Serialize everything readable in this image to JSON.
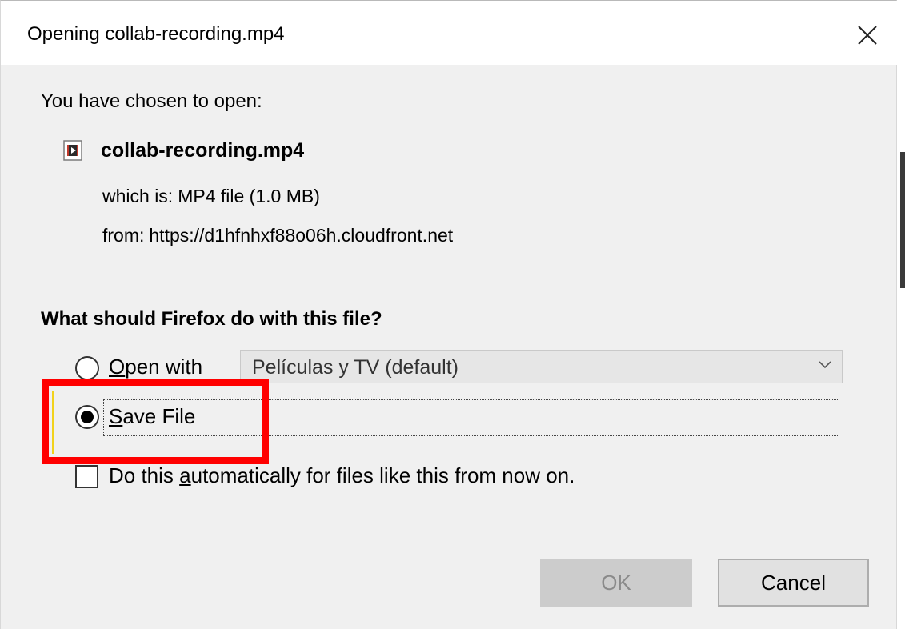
{
  "window": {
    "title": "Opening collab-recording.mp4",
    "close_icon": "close-icon"
  },
  "intro": "You have chosen to open:",
  "file": {
    "icon": "video-file-icon",
    "name": "collab-recording.mp4",
    "type_label": "which is:",
    "type_value": "MP4 file (1.0 MB)",
    "from_label": "from:",
    "from_value": "https://d1hfnhxf88o06h.cloudfront.net"
  },
  "question": "What should Firefox do with this file?",
  "options": {
    "open_with": {
      "label_accel": "O",
      "label_rest": "pen with",
      "selected": false,
      "app_value": "Películas y TV (default)"
    },
    "save_file": {
      "label_accel": "S",
      "label_rest": "ave File",
      "selected": true
    }
  },
  "auto": {
    "label_pre": "Do this ",
    "label_accel": "a",
    "label_rest": "utomatically for files like this from now on.",
    "checked": false
  },
  "buttons": {
    "ok": "OK",
    "cancel": "Cancel"
  },
  "colors": {
    "dialog_bg": "#f0f0f0",
    "highlight": "#ff0000",
    "disabled_text": "#8a8a8a"
  }
}
